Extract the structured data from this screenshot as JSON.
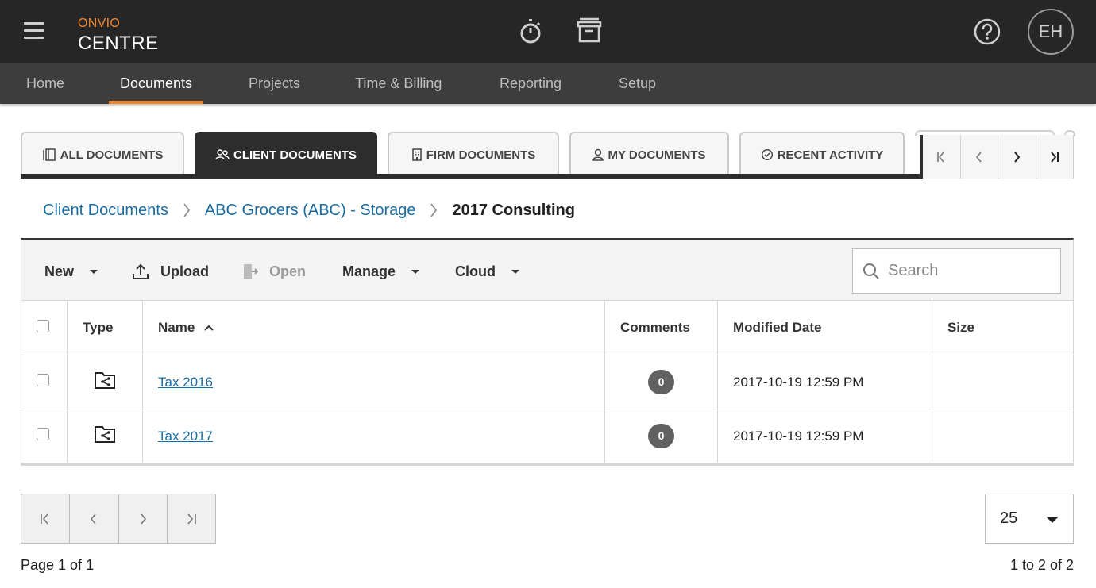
{
  "brand": {
    "top": "ONVIO",
    "bottom": "CENTRE"
  },
  "header": {
    "icons": [
      "hamburger-icon",
      "stopwatch-icon",
      "archive-icon",
      "help-icon"
    ],
    "avatar_initials": "EH"
  },
  "nav": {
    "items": [
      {
        "label": "Home",
        "active": false
      },
      {
        "label": "Documents",
        "active": true
      },
      {
        "label": "Projects",
        "active": false
      },
      {
        "label": "Time & Billing",
        "active": false
      },
      {
        "label": "Reporting",
        "active": false
      },
      {
        "label": "Setup",
        "active": false
      }
    ]
  },
  "tabs": [
    {
      "label": "ALL DOCUMENTS",
      "icon": "all-documents-icon",
      "active": false
    },
    {
      "label": "CLIENT DOCUMENTS",
      "icon": "people-icon",
      "active": true
    },
    {
      "label": "FIRM DOCUMENTS",
      "icon": "building-icon",
      "active": false
    },
    {
      "label": "MY DOCUMENTS",
      "icon": "person-icon",
      "active": false
    },
    {
      "label": "RECENT ACTIVITY",
      "icon": "clock-check-icon",
      "active": false
    }
  ],
  "breadcrumb": {
    "items": [
      {
        "label": "Client Documents",
        "link": true
      },
      {
        "label": "ABC Grocers (ABC) - Storage",
        "link": true
      },
      {
        "label": "2017 Consulting",
        "link": false
      }
    ]
  },
  "toolbar": {
    "new_label": "New",
    "upload_label": "Upload",
    "open_label": "Open",
    "manage_label": "Manage",
    "cloud_label": "Cloud",
    "search_placeholder": "Search"
  },
  "table": {
    "columns": [
      "",
      "Type",
      "Name",
      "Comments",
      "Modified Date",
      "Size"
    ],
    "sort": {
      "column": "Name",
      "direction": "ascending"
    },
    "rows": [
      {
        "type": "shared-folder-icon",
        "name": "Tax 2016",
        "comments": "0",
        "modified": "2017-10-19 12:59 PM",
        "size": ""
      },
      {
        "type": "shared-folder-icon",
        "name": "Tax 2017",
        "comments": "0",
        "modified": "2017-10-19 12:59 PM",
        "size": ""
      }
    ]
  },
  "pagination": {
    "page_info": "Page 1 of 1",
    "range_info": "1 to 2 of 2",
    "page_size": "25"
  },
  "colors": {
    "header_bg": "#262626",
    "nav_bg": "#3d3d3d",
    "accent": "#f2852c",
    "link": "#1a6da3",
    "active_tab": "#2d2d2d"
  }
}
